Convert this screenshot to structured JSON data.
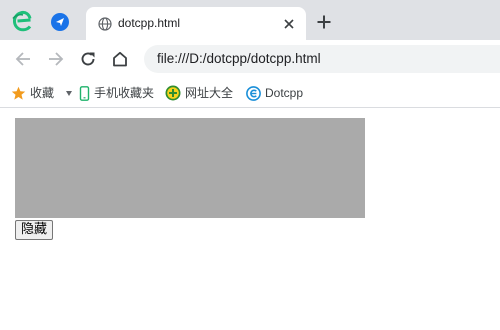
{
  "browser": {
    "tab": {
      "title": "dotcpp.html"
    },
    "address_bar": {
      "url": "file:///D:/dotcpp/dotcpp.html"
    },
    "bookmarks": [
      {
        "label": "收藏",
        "icon": "star-icon"
      },
      {
        "label": "手机收藏夹",
        "icon": "phone-icon"
      },
      {
        "label": "网址大全",
        "icon": "hao-icon"
      },
      {
        "label": "Dotcpp",
        "icon": "dotcpp-icon"
      }
    ]
  },
  "page": {
    "box_color": "#aaaaaa",
    "hide_button_label": "隐藏"
  }
}
